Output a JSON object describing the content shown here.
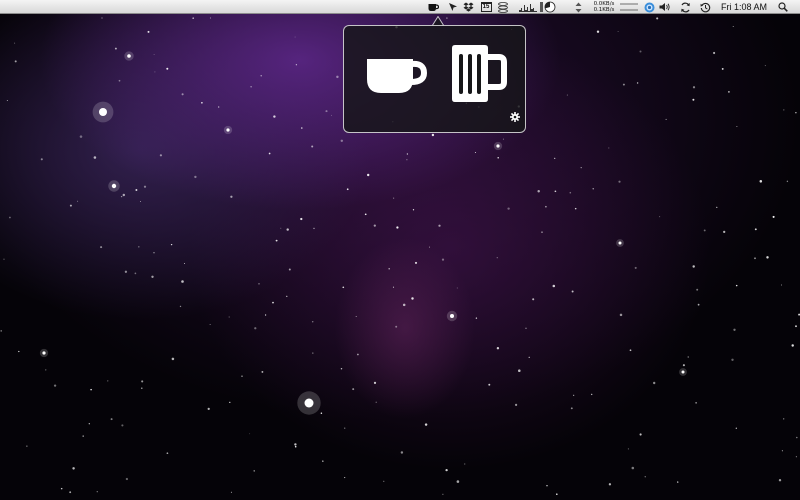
{
  "menubar": {
    "clock": "Fri 1:08 AM",
    "network": {
      "download_rate": "0.0KB/s",
      "upload_rate": "0.1KB/s"
    },
    "calendar_day": "15",
    "icons": [
      "coffee-cup-icon",
      "cursor-icon",
      "dropbox-icon",
      "calendar-icon",
      "disk-stack-icon",
      "cpu-graph-icon",
      "memory-pie-icon",
      "up-down-arrows-icon",
      "network-rates",
      "sliders-icon",
      "status-globe-icon",
      "volume-icon",
      "sync-icon",
      "time-machine-icon",
      "spotlight-search-icon"
    ]
  },
  "popover": {
    "options": [
      {
        "name": "coffee",
        "icon": "coffee-cup-icon"
      },
      {
        "name": "beer",
        "icon": "beer-mug-icon"
      }
    ],
    "settings_icon": "gear-icon"
  },
  "colors": {
    "menubar_top": "#f4f4f4",
    "menubar_bottom": "#d9d9d9",
    "popover_bg": "#161618",
    "popover_border": "#ffffff",
    "nebula_purple": "#5f2880"
  }
}
